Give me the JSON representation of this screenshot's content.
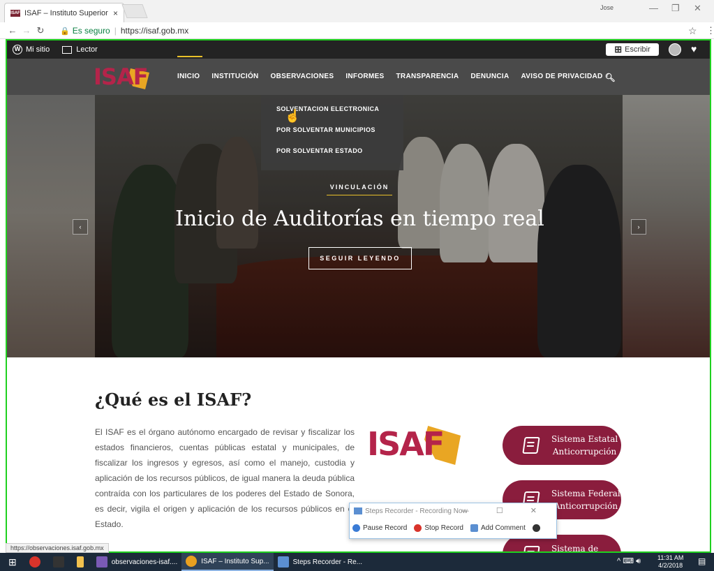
{
  "browser": {
    "tab_title": "ISAF – Instituto Superior",
    "tab_close": "×",
    "favicon": "ISAF",
    "user_label": "Jose",
    "secure_label": "Es seguro",
    "url": "https://isaf.gob.mx",
    "status_url": "https://observaciones.isaf.gob.mx"
  },
  "wpbar": {
    "my_site": "Mi sitio",
    "reader": "Lector",
    "write": "Escribir"
  },
  "site": {
    "logo_text": "ISAF",
    "nav": [
      "INICIO",
      "INSTITUCIÓN",
      "OBSERVACIONES",
      "INFORMES",
      "TRANSPARENCIA",
      "DENUNCIA",
      "AVISO DE PRIVACIDAD"
    ],
    "dropdown": [
      "SOLVENTACION ELECTRONICA",
      "POR SOLVENTAR MUNICIPIOS",
      "POR SOLVENTAR ESTADO"
    ]
  },
  "hero": {
    "category": "VINCULACIÓN",
    "title": "Inicio de Auditorías en tiempo real",
    "button": "SEGUIR LEYENDO",
    "prev": "‹",
    "next": "›"
  },
  "content": {
    "title": "¿Qué es el ISAF?",
    "body": "El ISAF es el órgano autónomo encargado de revisar y fiscalizar los estados financieros, cuentas públicas estatal y municipales, de fiscalizar los ingresos y egresos, así como el manejo, custodia y aplicación de los recursos públicos, de igual manera la deuda pública contraída con los particulares de los poderes del Estado de Sonora, es decir, vigila el origen y aplicación de los recursos públicos en el Estado.",
    "logo_text": "ISAF",
    "pills": [
      {
        "line1": "Sistema Estatal",
        "line2": "Anticorrupción"
      },
      {
        "line1": "Sistema Federal",
        "line2": "Anticorrupción"
      },
      {
        "line1": "Sistema de",
        "line2": ""
      }
    ]
  },
  "recorder": {
    "title": "Steps Recorder - Recording Now",
    "pause": "Pause Record",
    "stop": "Stop Record",
    "comment": "Add Comment"
  },
  "taskbar": {
    "items": [
      "observaciones-isaf....",
      "ISAF – Instituto Sup...",
      "Steps Recorder - Re..."
    ],
    "time": "11:31 AM",
    "date": "4/2/2018"
  }
}
